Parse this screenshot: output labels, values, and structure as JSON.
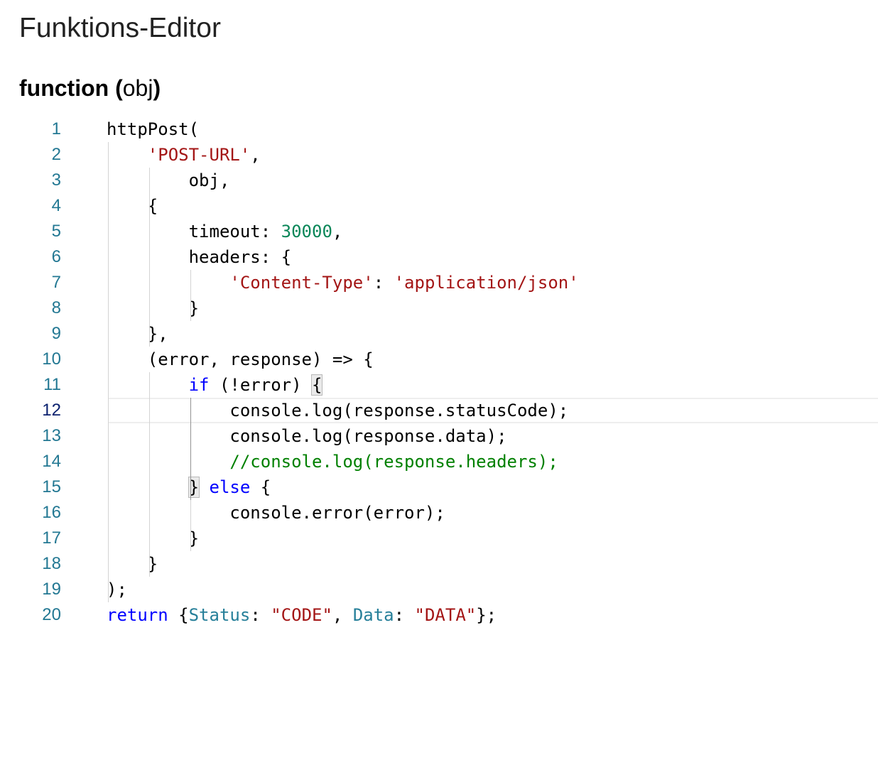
{
  "page_title": "Funktions-Editor",
  "signature": {
    "keyword": "function",
    "open_paren": "(",
    "param": "obj",
    "close_paren": ")"
  },
  "editor": {
    "active_line": 12,
    "line_numbers": [
      "1",
      "2",
      "3",
      "4",
      "5",
      "6",
      "7",
      "8",
      "9",
      "10",
      "11",
      "12",
      "13",
      "14",
      "15",
      "16",
      "17",
      "18",
      "19",
      "20"
    ],
    "colors": {
      "line_number": "#237893",
      "string": "#a31515",
      "number": "#098658",
      "keyword": "#0000ff",
      "comment": "#008000",
      "property": "#267f99"
    },
    "lines": [
      [
        {
          "t": "httpPost("
        }
      ],
      [
        {
          "t": "    "
        },
        {
          "t": "'POST-URL'",
          "c": "str"
        },
        {
          "t": ","
        }
      ],
      [
        {
          "t": "        obj,"
        }
      ],
      [
        {
          "t": "    {"
        }
      ],
      [
        {
          "t": "        timeout: "
        },
        {
          "t": "30000",
          "c": "num"
        },
        {
          "t": ","
        }
      ],
      [
        {
          "t": "        headers: {"
        }
      ],
      [
        {
          "t": "            "
        },
        {
          "t": "'Content-Type'",
          "c": "str"
        },
        {
          "t": ": "
        },
        {
          "t": "'application/json'",
          "c": "str"
        }
      ],
      [
        {
          "t": "        }"
        }
      ],
      [
        {
          "t": "    },"
        }
      ],
      [
        {
          "t": "    (error, response) => {"
        }
      ],
      [
        {
          "t": "        "
        },
        {
          "t": "if",
          "c": "kw"
        },
        {
          "t": " (!error) "
        },
        {
          "t": "{",
          "c": "bracket-match"
        }
      ],
      [
        {
          "t": "            console.log(response.statusCode);"
        }
      ],
      [
        {
          "t": "            console.log(response.data);"
        }
      ],
      [
        {
          "t": "            "
        },
        {
          "t": "//console.log(response.headers);",
          "c": "cmt"
        }
      ],
      [
        {
          "t": "        "
        },
        {
          "t": "}",
          "c": "bracket-match"
        },
        {
          "t": " "
        },
        {
          "t": "else",
          "c": "kw"
        },
        {
          "t": " {"
        }
      ],
      [
        {
          "t": "            console.error(error);"
        }
      ],
      [
        {
          "t": "        }"
        }
      ],
      [
        {
          "t": "    }"
        }
      ],
      [
        {
          "t": ");"
        }
      ],
      [
        {
          "t": "return",
          "c": "kw"
        },
        {
          "t": " {"
        },
        {
          "t": "Status",
          "c": "prop"
        },
        {
          "t": ": "
        },
        {
          "t": "\"CODE\"",
          "c": "str"
        },
        {
          "t": ", "
        },
        {
          "t": "Data",
          "c": "prop"
        },
        {
          "t": ": "
        },
        {
          "t": "\"DATA\"",
          "c": "str"
        },
        {
          "t": "};"
        }
      ]
    ]
  }
}
